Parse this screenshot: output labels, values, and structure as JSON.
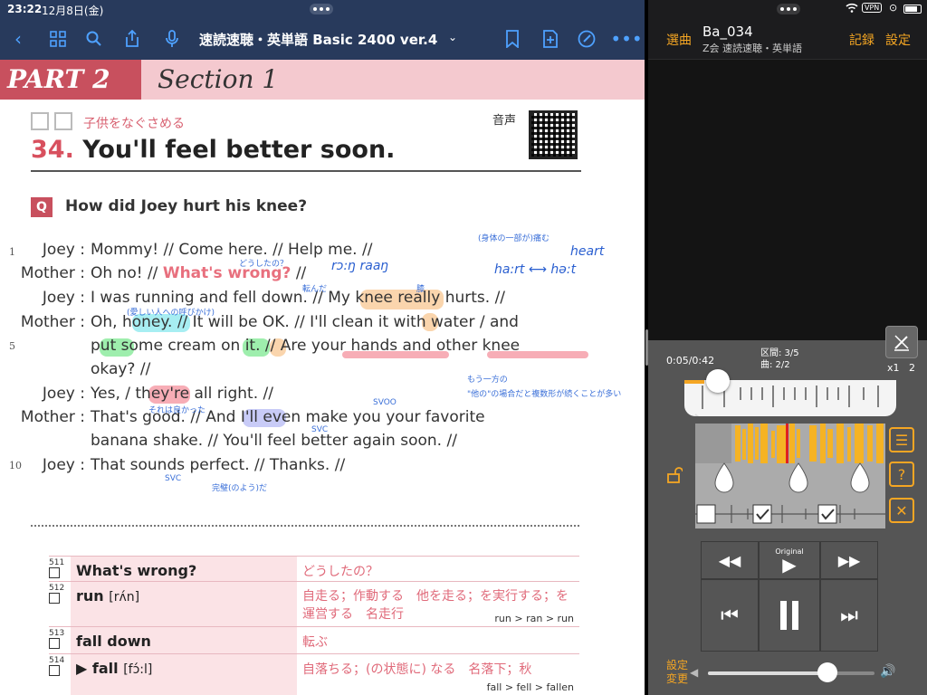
{
  "status": {
    "time": "23:22",
    "date": "12月8日(金)"
  },
  "nav": {
    "title": "速読速聴・英単語 Basic 2400 ver.4",
    "caret": "⌄"
  },
  "page": {
    "part": "PART 2",
    "section": "Section 1",
    "subtitle_jp": "子供をなぐさめる",
    "audio_label": "音声",
    "lesson_number": "34.",
    "lesson_title": "You'll feel better soon.",
    "q_badge": "Q",
    "question": "How did Joey hurt his knee?",
    "line_numbers": [
      "1",
      "5",
      "10"
    ],
    "dialogue": [
      {
        "speaker": "Joey :",
        "text": "Mommy! // Come here. // Help me. //"
      },
      {
        "speaker": "Mother :",
        "pre": "Oh no! // ",
        "hl": "What's wrong?",
        "post": " //"
      },
      {
        "speaker": "Joey :",
        "text": "I was running and fell down. // My knee really hurts. //"
      },
      {
        "speaker": "Mother :",
        "text": "Oh, honey. // It will be OK. // I'll clean it with water / and"
      },
      {
        "speaker": "",
        "text": "put some cream on it. // Are your hands and other knee"
      },
      {
        "speaker": "",
        "text": "okay? //"
      },
      {
        "speaker": "Joey :",
        "text": "Yes, / they're all right. //"
      },
      {
        "speaker": "Mother :",
        "text": "That's good. // And I'll even make you your favorite"
      },
      {
        "speaker": "",
        "text": "banana shake. // You'll feel better again soon. //"
      },
      {
        "speaker": "Joey :",
        "text": "That sounds perfect. // Thanks. //"
      }
    ],
    "annotations": {
      "doushitano": "どうしたの？",
      "koronda": "転んだ",
      "hiza": "膝",
      "itamu": "(身体の一部が)痛む",
      "aijou": "(愛しい人への呼びかけ)",
      "mouippou": "もう一方の",
      "tano": "\"他の\"の場合だと複数形が続くことが多い",
      "soreha": "それは良かった",
      "svoo": "SVOO",
      "svc1": "SVC",
      "svc2": "SVC",
      "kanpeki": "完璧(のよう)だ",
      "rong": "rɔ:ŋ raaŋ",
      "hart": "ha:rt ⟷ hə:t",
      "heart": "heart"
    },
    "vocab": [
      {
        "num": "511",
        "word": "What's wrong?",
        "pron": "",
        "meaning": "どうしたの？",
        "conj": ""
      },
      {
        "num": "512",
        "word": "run",
        "pron": "[rʌ́n]",
        "meaning": "自走る；作動する　他を走る；を実行する；を運営する　名走行",
        "conj": "run > ran > run"
      },
      {
        "num": "513",
        "word": "fall down",
        "pron": "",
        "meaning": "転ぶ",
        "conj": ""
      },
      {
        "num": "514",
        "word": "▶ fall",
        "pron": "[fɔ́:l]",
        "meaning": "自落ちる；(の状態に) なる　名落下；秋",
        "conj": "fall > fell > fallen"
      }
    ]
  },
  "player": {
    "select_label": "選曲",
    "track_name": "Ba_034",
    "track_sub": "Z会 速読速聴・英単語",
    "record_label": "記録",
    "settings_label": "設定",
    "time": "0:05/0:42",
    "section_info": "区間: 3/5",
    "song_info": "曲: 2/2",
    "speed_a": "x1",
    "speed_b": "2",
    "original_label": "Original",
    "setting_change_label": "設定\n変更",
    "volume_fraction": 0.72,
    "accent": "#f5a623"
  }
}
